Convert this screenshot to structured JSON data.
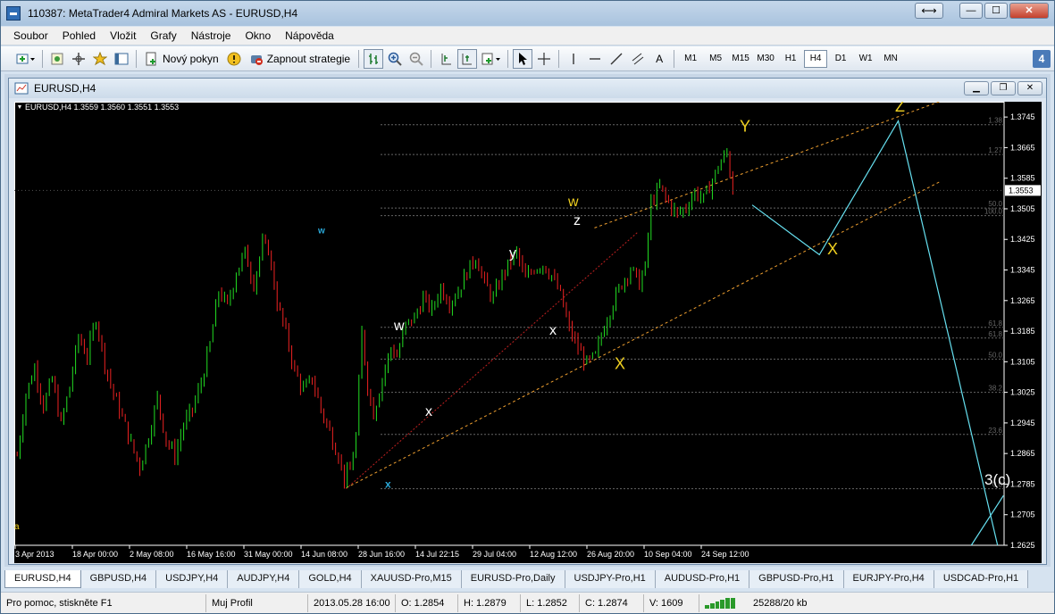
{
  "window": {
    "title": "110387: MetaTrader4 Admiral Markets AS - EURUSD,H4",
    "btn_restore_ext": "⟷",
    "btn_min": "—",
    "btn_max": "☐",
    "btn_close": "✕"
  },
  "menu": [
    "Soubor",
    "Pohled",
    "Vložit",
    "Grafy",
    "Nástroje",
    "Okno",
    "Nápověda"
  ],
  "toolbar": {
    "new_order": "Nový pokyn",
    "autotrading": "Zapnout strategie",
    "text_tool": "A",
    "timeframes": [
      "M1",
      "M5",
      "M15",
      "M30",
      "H1",
      "H4",
      "D1",
      "W1",
      "MN"
    ],
    "active_timeframe": "H4",
    "badge": "4"
  },
  "chart_window": {
    "title": "EURUSD,H4",
    "info": "EURUSD,H4  1.3559 1.3560 1.3551 1.3553"
  },
  "chart_data": {
    "type": "candlestick",
    "symbol": "EURUSD",
    "timeframe": "H4",
    "ohlc_header": {
      "open": 1.3559,
      "high": 1.356,
      "low": 1.3551,
      "close": 1.3553
    },
    "current_price": 1.3553,
    "ylim": [
      1.2625,
      1.3785
    ],
    "y_ticks": [
      1.3745,
      1.3665,
      1.3585,
      1.3505,
      1.3425,
      1.3345,
      1.3265,
      1.3185,
      1.3105,
      1.3025,
      1.2945,
      1.2865,
      1.2785,
      1.2705,
      1.2625
    ],
    "x_ticks": [
      "3 Apr 2013",
      "18 Apr 00:00",
      "2 May 08:00",
      "16 May 16:00",
      "31 May 00:00",
      "14 Jun 08:00",
      "28 Jun 16:00",
      "14 Jul 22:15",
      "29 Jul 04:00",
      "12 Aug 12:00",
      "26 Aug 20:00",
      "10 Sep 04:00",
      "24 Sep 12:00"
    ],
    "price_path": [
      [
        0,
        1.286
      ],
      [
        3,
        1.302
      ],
      [
        6,
        1.309
      ],
      [
        9,
        1.299
      ],
      [
        12,
        1.306
      ],
      [
        15,
        1.294
      ],
      [
        18,
        1.304
      ],
      [
        21,
        1.317
      ],
      [
        24,
        1.312
      ],
      [
        27,
        1.322
      ],
      [
        30,
        1.31
      ],
      [
        33,
        1.302
      ],
      [
        36,
        1.296
      ],
      [
        39,
        1.289
      ],
      [
        42,
        1.283
      ],
      [
        45,
        1.291
      ],
      [
        48,
        1.301
      ],
      [
        51,
        1.29
      ],
      [
        54,
        1.286
      ],
      [
        57,
        1.294
      ],
      [
        60,
        1.298
      ],
      [
        63,
        1.305
      ],
      [
        66,
        1.315
      ],
      [
        69,
        1.329
      ],
      [
        72,
        1.325
      ],
      [
        75,
        1.334
      ],
      [
        78,
        1.339
      ],
      [
        81,
        1.331
      ],
      [
        84,
        1.341
      ],
      [
        86,
        1.34
      ],
      [
        89,
        1.326
      ],
      [
        92,
        1.318
      ],
      [
        95,
        1.308
      ],
      [
        98,
        1.303
      ],
      [
        101,
        1.306
      ],
      [
        104,
        1.298
      ],
      [
        107,
        1.292
      ],
      [
        110,
        1.286
      ],
      [
        112,
        1.28
      ],
      [
        114,
        1.282
      ],
      [
        116,
        1.291
      ],
      [
        118,
        1.318
      ],
      [
        120,
        1.304
      ],
      [
        122,
        1.297
      ],
      [
        124,
        1.303
      ],
      [
        126,
        1.309
      ],
      [
        128,
        1.314
      ],
      [
        130,
        1.312
      ],
      [
        133,
        1.32
      ],
      [
        136,
        1.322
      ],
      [
        139,
        1.327
      ],
      [
        142,
        1.324
      ],
      [
        145,
        1.33
      ],
      [
        148,
        1.326
      ],
      [
        151,
        1.329
      ],
      [
        154,
        1.334
      ],
      [
        157,
        1.338
      ],
      [
        160,
        1.331
      ],
      [
        163,
        1.327
      ],
      [
        166,
        1.333
      ],
      [
        169,
        1.337
      ],
      [
        171,
        1.339
      ],
      [
        174,
        1.332
      ],
      [
        177,
        1.335
      ],
      [
        180,
        1.336
      ],
      [
        183,
        1.333
      ],
      [
        186,
        1.328
      ],
      [
        189,
        1.319
      ],
      [
        192,
        1.314
      ],
      [
        195,
        1.31
      ],
      [
        198,
        1.312
      ],
      [
        201,
        1.32
      ],
      [
        204,
        1.326
      ],
      [
        207,
        1.331
      ],
      [
        210,
        1.335
      ],
      [
        213,
        1.331
      ],
      [
        215,
        1.335
      ],
      [
        217,
        1.352
      ],
      [
        220,
        1.356
      ],
      [
        223,
        1.352
      ],
      [
        226,
        1.349
      ],
      [
        229,
        1.351
      ],
      [
        232,
        1.355
      ],
      [
        235,
        1.353
      ],
      [
        238,
        1.358
      ],
      [
        241,
        1.363
      ],
      [
        243,
        1.365
      ],
      [
        245,
        1.3553
      ]
    ],
    "projection": [
      [
        1.3515,
        0
      ],
      [
        1.3385,
        1
      ],
      [
        1.3735,
        2
      ],
      [
        1.2625,
        3
      ]
    ],
    "wave_labels": [
      {
        "text": "w",
        "price": 1.3441,
        "color": "#2aa8d8"
      },
      {
        "text": "x",
        "price": 1.2775,
        "color": "#2aa8d8"
      },
      {
        "text": "w",
        "price": 1.3187,
        "color": "#ffffff"
      },
      {
        "text": "x",
        "price": 1.2964,
        "color": "#ffffff"
      },
      {
        "text": "y",
        "price": 1.3378,
        "color": "#ffffff"
      },
      {
        "text": "x",
        "price": 1.3176,
        "color": "#ffffff"
      },
      {
        "text": "z",
        "price": 1.3463,
        "color": "#ffffff"
      },
      {
        "text": "w",
        "price": 1.3512,
        "color": "#f0d020"
      },
      {
        "text": "X",
        "price": 1.3086,
        "color": "#f0d020"
      },
      {
        "text": "Y",
        "price": 1.3707,
        "color": "#f0d020"
      },
      {
        "text": "X",
        "price": 1.3386,
        "color": "#f0d020"
      },
      {
        "text": "Z",
        "price": 1.3759,
        "color": "#f0d020"
      },
      {
        "text": "3(c)",
        "price": 1.2784,
        "color": "#ffffff"
      },
      {
        "text": "a",
        "price": 1.2667,
        "color": "#f0d020"
      }
    ],
    "fib_levels": [
      {
        "label": "1.38",
        "price": 1.3725
      },
      {
        "label": "1.27",
        "price": 1.3647
      },
      {
        "label": "50.0",
        "price": 1.3507
      },
      {
        "label": "100.0",
        "price": 1.3487
      },
      {
        "label": "61.8",
        "price": 1.3195
      },
      {
        "label": "61.8",
        "price": 1.3167
      },
      {
        "label": "50.0",
        "price": 1.3112
      },
      {
        "label": "38.2",
        "price": 1.3025
      },
      {
        "label": "23.6",
        "price": 1.2915
      },
      {
        "label": "0.0",
        "price": 1.2773
      }
    ]
  },
  "tabs": [
    "EURUSD,H4",
    "GBPUSD,H4",
    "USDJPY,H4",
    "AUDJPY,H4",
    "GOLD,H4",
    "XAUUSD-Pro,M15",
    "EURUSD-Pro,Daily",
    "USDJPY-Pro,H1",
    "AUDUSD-Pro,H1",
    "GBPUSD-Pro,H1",
    "EURJPY-Pro,H4",
    "USDCAD-Pro,H1"
  ],
  "status": {
    "help": "Pro pomoc, stiskněte F1",
    "profile": "Muj Profil",
    "datetime": "2013.05.28 16:00",
    "open": "O: 1.2854",
    "high": "H: 1.2879",
    "low": "L: 1.2852",
    "close": "C: 1.2874",
    "volume": "V: 1609",
    "traffic": "25288/20 kb"
  }
}
